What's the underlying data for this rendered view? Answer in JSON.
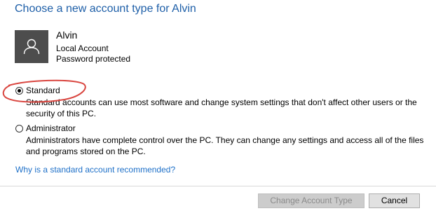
{
  "header": {
    "title": "Choose a new account type for Alvin"
  },
  "account": {
    "avatar_icon": "user-icon",
    "name": "Alvin",
    "type": "Local Account",
    "password_status": "Password protected"
  },
  "options": [
    {
      "label": "Standard",
      "description": "Standard accounts can use most software and change system settings that don't affect other users or the security of this PC.",
      "selected": true
    },
    {
      "label": "Administrator",
      "description": "Administrators have complete control over the PC. They can change any settings and access all of the files and programs stored on the PC.",
      "selected": false
    }
  ],
  "help_link": "Why is a standard account recommended?",
  "buttons": {
    "change_label": "Change Account Type",
    "change_enabled": false,
    "cancel_label": "Cancel"
  },
  "colors": {
    "title": "#1e5fa8",
    "link": "#1e70c8",
    "annotation": "#d9453f",
    "avatar_bg": "#4d4d4d"
  }
}
